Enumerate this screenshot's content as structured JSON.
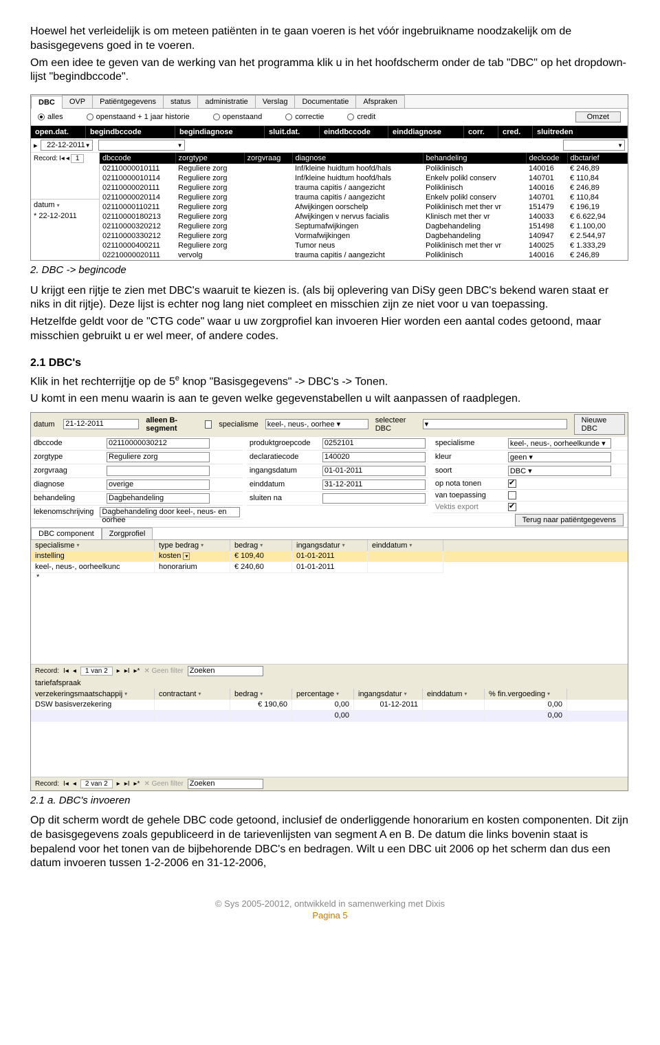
{
  "intro": {
    "p1": "Hoewel het verleidelijk is om meteen patiënten in te gaan voeren is het vóór ingebruikname noodzakelijk om de basisgegevens goed in te voeren.",
    "p2": "Om een idee te geven van de werking van het programma klik u in het hoofdscherm onder de tab \"DBC\" op het dropdown-lijst \"begindbccode\"."
  },
  "ss1": {
    "tabs": [
      "DBC",
      "OVP",
      "Patiëntgegevens",
      "status",
      "administratie",
      "Verslag",
      "Documentatie",
      "Afspraken"
    ],
    "radios": [
      "alles",
      "openstaand + 1 jaar historie",
      "openstaand",
      "correctie",
      "credit"
    ],
    "omzet": "Omzet",
    "headers_top": [
      "open.dat.",
      "begindbccode",
      "begindiagnose",
      "sluit.dat.",
      "einddbccode",
      "einddiagnose",
      "corr.",
      "cred.",
      "sluitreden"
    ],
    "open_dat": "22-12-2011",
    "record_label": "Record:",
    "record_nav": "1",
    "datum_label": "datum",
    "star_date": "22-12-2011",
    "headers_sub": [
      "dbccode",
      "zorgtype",
      "zorgvraag",
      "diagnose",
      "behandeling",
      "declcode",
      "dbctarief"
    ],
    "rows": [
      {
        "c": "02110000010111",
        "zt": "Reguliere zorg",
        "zv": "",
        "di": "Inf/kleine huidtum hoofd/hals",
        "be": "Poliklinisch",
        "dc": "140016",
        "ta": "€ 246,89"
      },
      {
        "c": "02110000010114",
        "zt": "Reguliere zorg",
        "zv": "",
        "di": "Inf/kleine huidtum hoofd/hals",
        "be": "Enkelv polikl conserv",
        "dc": "140701",
        "ta": "€ 110,84"
      },
      {
        "c": "02110000020111",
        "zt": "Reguliere zorg",
        "zv": "",
        "di": "trauma capitis / aangezicht",
        "be": "Poliklinisch",
        "dc": "140016",
        "ta": "€ 246,89"
      },
      {
        "c": "02110000020114",
        "zt": "Reguliere zorg",
        "zv": "",
        "di": "trauma capitis / aangezicht",
        "be": "Enkelv polikl conserv",
        "dc": "140701",
        "ta": "€ 110,84"
      },
      {
        "c": "02110000110211",
        "zt": "Reguliere zorg",
        "zv": "",
        "di": "Afwijkingen oorschelp",
        "be": "Poliklinisch met ther vr",
        "dc": "151479",
        "ta": "€ 196,19"
      },
      {
        "c": "02110000180213",
        "zt": "Reguliere zorg",
        "zv": "",
        "di": "Afwijkingen v nervus facialis",
        "be": "Klinisch met ther vr",
        "dc": "140033",
        "ta": "€ 6.622,94"
      },
      {
        "c": "02110000320212",
        "zt": "Reguliere zorg",
        "zv": "",
        "di": "Septumafwijkingen",
        "be": "Dagbehandeling",
        "dc": "151498",
        "ta": "€ 1.100,00"
      },
      {
        "c": "02110000330212",
        "zt": "Reguliere zorg",
        "zv": "",
        "di": "Vormafwijkingen",
        "be": "Dagbehandeling",
        "dc": "140947",
        "ta": "€ 2.544,97"
      },
      {
        "c": "02110000400211",
        "zt": "Reguliere zorg",
        "zv": "",
        "di": "Tumor neus",
        "be": "Poliklinisch met ther vr",
        "dc": "140025",
        "ta": "€ 1.333,29"
      },
      {
        "c": "02210000020111",
        "zt": "vervolg",
        "zv": "",
        "di": "trauma capitis / aangezicht",
        "be": "Poliklinisch",
        "dc": "140016",
        "ta": "€ 246,89"
      }
    ]
  },
  "caption1": "2. DBC -> begincode",
  "mid": {
    "p1a": "U krijgt een rijtje te zien met DBC's waaruit te kiezen is. (als bij oplevering van DiSy geen DBC's bekend waren staat er niks in dit rijtje). Deze lijst is echter nog lang niet compleet en misschien zijn ze niet voor u van toepassing.",
    "p1b": "Hetzelfde geldt voor de \"CTG code\" waar u uw zorgprofiel kan invoeren Hier worden een aantal codes getoond, maar misschien gebruikt u er wel meer, of andere codes."
  },
  "section21_title": "2.1 DBC's",
  "section21": {
    "line1a": "Klik in het rechterrijtje op de 5",
    "line1sup": "e",
    "line1b": " knop  \"Basisgegevens\"  -> DBC's -> Tonen.",
    "line2": "U komt in een menu waarin is aan te geven welke gegevenstabellen u wilt aanpassen of raadplegen."
  },
  "ss2": {
    "top": {
      "datum_l": "datum",
      "datum_v": "21-12-2011",
      "alleenB": "alleen B-segment",
      "spec_l": "specialisme",
      "spec_v": "keel-, neus-, oorhee",
      "selDBC_l": "selecteer DBC",
      "nieuwe": "Nieuwe DBC"
    },
    "left": [
      {
        "l": "dbccode",
        "v": "02110000030212"
      },
      {
        "l": "zorgtype",
        "v": "Reguliere zorg"
      },
      {
        "l": "zorgvraag",
        "v": ""
      },
      {
        "l": "diagnose",
        "v": "overige"
      },
      {
        "l": "behandeling",
        "v": "Dagbehandeling"
      },
      {
        "l": "lekenomschrijving",
        "v": "Dagbehandeling door keel-, neus- en oorhee"
      }
    ],
    "midcol": [
      {
        "l": "produktgroepcode",
        "v": "0252101"
      },
      {
        "l": "declaratiecode",
        "v": "140020"
      },
      {
        "l": "ingangsdatum",
        "v": "01-01-2011"
      },
      {
        "l": "einddatum",
        "v": "31-12-2011"
      },
      {
        "l": "sluiten na",
        "v": ""
      }
    ],
    "rightcol": [
      {
        "l": "specialisme",
        "v": "keel-, neus-, oorheelkunde",
        "type": "drop"
      },
      {
        "l": "kleur",
        "v": "geen",
        "type": "drop"
      },
      {
        "l": "soort",
        "v": "DBC",
        "type": "drop"
      },
      {
        "l": "op nota tonen",
        "type": "check",
        "checked": true
      },
      {
        "l": "van toepassing",
        "type": "check",
        "checked": false
      },
      {
        "l": "Vektis export",
        "type": "check",
        "checked": true,
        "grey": true
      }
    ],
    "terug": "Terug naar patiëntgegevens",
    "tabs": [
      "DBC component",
      "Zorgprofiel"
    ],
    "grid1": {
      "hdr": [
        "specialisme",
        "type bedrag",
        "bedrag",
        "ingangsdatur",
        "einddatum"
      ],
      "rows": [
        {
          "sp": "instelling",
          "tb": "kosten",
          "bd": "€ 109,40",
          "in": "01-01-2011",
          "ed": ""
        },
        {
          "sp": "keel-, neus-, oorheelkunc",
          "tb": "honorarium",
          "bd": "€ 240,60",
          "in": "01-01-2011",
          "ed": ""
        }
      ]
    },
    "recbar1": {
      "txt": "1 van 2",
      "gf": "Geen filter",
      "zk": "Zoeken"
    },
    "tarief_l": "tariefafspraak",
    "grid2": {
      "hdr": [
        "verzekeringsmaatschappij",
        "contractant",
        "bedrag",
        "percentage",
        "ingangsdatur",
        "einddatum",
        "% fin.vergoeding"
      ],
      "rows": [
        {
          "v": "DSW basisverzekering",
          "c": "",
          "b": "€ 190,60",
          "p": "0,00",
          "i": "01-12-2011",
          "e": "",
          "f": "0,00"
        },
        {
          "v": "",
          "c": "",
          "b": "",
          "p": "0,00",
          "i": "",
          "e": "",
          "f": "0,00"
        }
      ]
    },
    "recbar2": {
      "txt": "2 van 2",
      "gf": "Geen filter",
      "zk": "Zoeken"
    }
  },
  "caption2": "2.1 a. DBC's invoeren",
  "outro": {
    "p1": "Op dit scherm wordt de gehele DBC code getoond, inclusief de onderliggende honorarium en kosten componenten. Dit zijn de basisgegevens zoals gepubliceerd in de tarievenlijsten van segment A en B. De datum die links bovenin staat is bepalend voor het tonen van de bijbehorende DBC's en bedragen. Wilt u een DBC uit 2006 op het scherm dan dus een datum invoeren tussen 1-2-2006 en 31-12-2006,"
  },
  "footer": {
    "copy": "© Sys 2005-20012, ontwikkeld in samenwerking met Dixis",
    "page": "Pagina 5"
  }
}
